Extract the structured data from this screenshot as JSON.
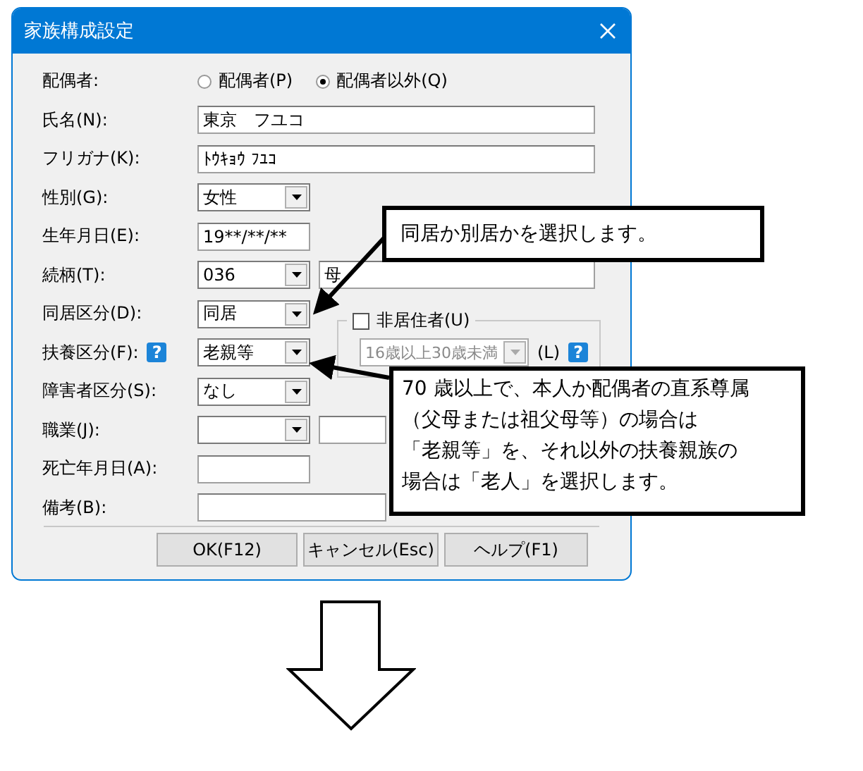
{
  "window": {
    "title": "家族構成設定"
  },
  "fields": [
    {
      "kind": "radio",
      "label": "配偶者:",
      "options": [
        {
          "label": "配偶者(P)",
          "selected": false
        },
        {
          "label": "配偶者以外(Q)",
          "selected": true
        }
      ]
    },
    {
      "kind": "text_wide",
      "label": "氏名(N):",
      "value": "東京　フユコ"
    },
    {
      "kind": "text_wide",
      "label": "フリガナ(K):",
      "value": "ﾄｳｷｮｳ ﾌﾕｺ"
    },
    {
      "kind": "combo",
      "label": "性別(G):",
      "value": "女性"
    },
    {
      "kind": "text_short",
      "label": "生年月日(E):",
      "value": "19**/**/**"
    },
    {
      "kind": "combo_pair",
      "label": "続柄(T):",
      "value": "036",
      "value_2": "母"
    },
    {
      "kind": "combo",
      "label": "同居区分(D):",
      "value": "同居"
    },
    {
      "kind": "combo",
      "label": "扶養区分(F):",
      "help": "?",
      "value": "老親等"
    },
    {
      "kind": "combo",
      "label": "障害者区分(S):",
      "value": "なし"
    },
    {
      "kind": "combo_partial",
      "label": "職業(J):"
    },
    {
      "kind": "text_short",
      "label": "死亡年月日(A):"
    },
    {
      "kind": "text_partial",
      "label": "備考(B):"
    }
  ],
  "non_resident": {
    "label": "非居住者(U)",
    "checked": false,
    "disabled": true,
    "value": "16歳以上30歳未満",
    "suffix": "(L)",
    "help": "?"
  },
  "buttons": [
    "OK(F12)",
    "キャンセル(Esc)",
    "ヘルプ(F1)"
  ],
  "callouts": [
    {
      "lines": [
        "同居か別居かを選択します。"
      ]
    },
    {
      "lines": [
        "70 歳以上で、本人か配偶者の直系尊属",
        "（父母または祖父母等）の場合は",
        "「老親等」を、それ以外の扶養親族の",
        "場合は「老人」を選択します。"
      ]
    }
  ]
}
